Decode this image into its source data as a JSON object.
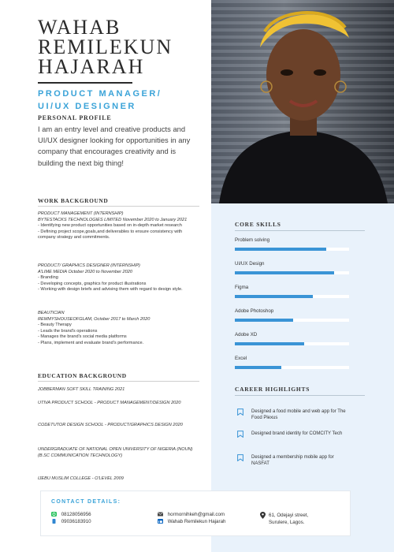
{
  "header": {
    "name_lines": [
      "WAHAB",
      "REMILEKUN",
      "HAJARAH"
    ],
    "role_lines": [
      "PRODUCT MANAGER/",
      "UI/UX DESIGNER"
    ]
  },
  "profile": {
    "heading": "PERSONAL PROFILE",
    "text": "I am an entry level and creative products and UI/UX designer looking for opportunities in any company that encourages creativity and is building the next big thing!"
  },
  "work": {
    "heading": "WORK BACKGROUND",
    "jobs": [
      {
        "title": "PRODUCT MANAGEMENT  (INTERNSHIP)",
        "company": "BYTESTACKS TECHNOLOGIES LIMITED November 2020 to January 2021",
        "bullets": [
          "- Identifying new product opportunities based on in-depth market research",
          "- Defining project scope,goals,and deliverables to ensure consistency with company strategy  and commitments."
        ]
      },
      {
        "title": "PRODUCT/ GRAPHICS DESIGNER (INTERNSHIP)",
        "company": "A'LIME MEDIA October 2020 to November 2020",
        "bullets": [
          "- Branding",
          "- Developing concepts, graphics for product illustrations",
          "- Working with design briefs and advising them with regard to design style."
        ]
      },
      {
        "title": "BEAUTICIAN",
        "company": "REMMYSHOUSEOFGLAM, October 2017 to March 2020",
        "bullets": [
          "- Beauty Therapy",
          "- Leads the brand's operations",
          "- Manages the brand's social media platforms",
          "- Plans, implement and evaluate brand's performance."
        ]
      }
    ]
  },
  "education": {
    "heading": "EDUCATION BACKGROUND",
    "items": [
      "JOBBERMAN SOFT SKILL TRAINING  2021",
      "UTIVA PRODUCT SCHOOL - PRODUCT MANAGEMENT/DESIGN 2020",
      "CODETUTOR DESIGN SCHOOL - PRODUCT/GRAPHICS DESIGN 2020",
      "UNDERGRADUATE OF NATIONAL OPEN UNIVERSITY OF NIGERIA (NOUN)\n(B.SC COMMUNICATION TECHNOLOGY)",
      "IJEBU MUSLIM COLLEGE - O'LEVEL 2009"
    ]
  },
  "skills": {
    "heading": "CORE SKILLS",
    "items": [
      {
        "label": "Problem solving",
        "level": 0.8
      },
      {
        "label": "UI/UX Design",
        "level": 0.87
      },
      {
        "label": "Figma",
        "level": 0.68
      },
      {
        "label": "Adobe Photoshop",
        "level": 0.51
      },
      {
        "label": "Adobe XD",
        "level": 0.61
      },
      {
        "label": "Excel",
        "level": 0.41
      }
    ],
    "bar_color": "#3a94d6"
  },
  "career": {
    "heading": "CAREER HIGHLIGHTS",
    "items": [
      "Designed a food mobile and web app for The Food Plexus",
      "Designed brand identity for COMCITY Tech",
      "Designed a membership mobile app for NASFAT"
    ]
  },
  "contact": {
    "title": "CONTACT DETAILS:",
    "phones": [
      "08128056956",
      "09036183910"
    ],
    "email": "hormornihkeh@gmail.com",
    "linkedin": "Wahab Remilekun Hajarah",
    "address_lines": [
      "61, Odejayi street,",
      "Surulere, Lagos."
    ]
  },
  "colors": {
    "accent": "#3aa3d8",
    "panel": "#e9f2fb"
  }
}
